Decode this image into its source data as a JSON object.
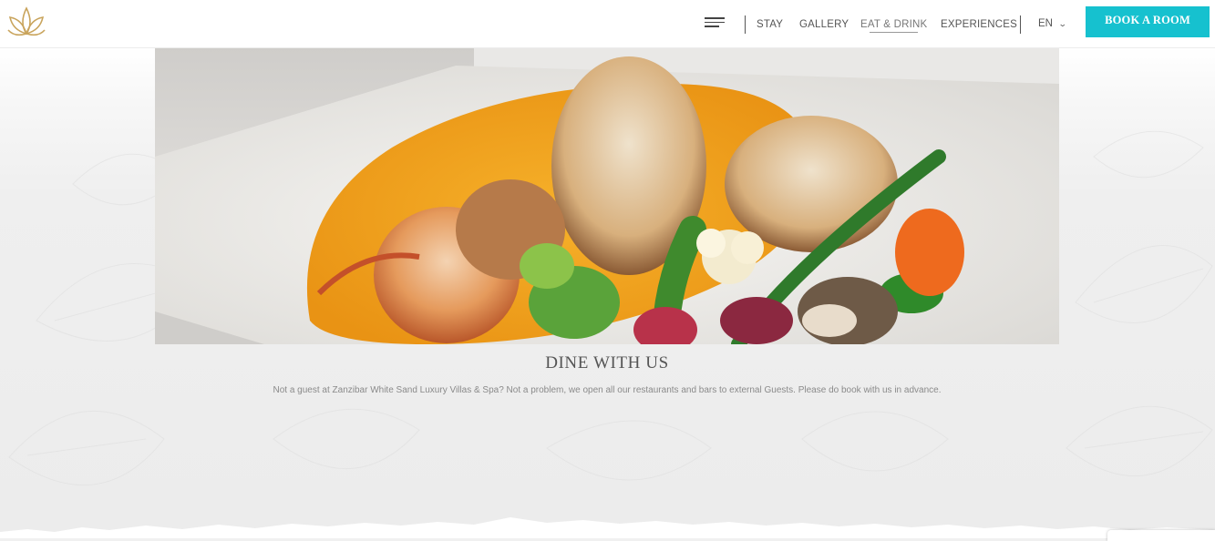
{
  "header": {
    "logo_icon": "lotus-logo-icon",
    "menu_icon": "hamburger-menu-icon",
    "nav": [
      {
        "label": "STAY",
        "active": false
      },
      {
        "label": "GALLERY",
        "active": false
      },
      {
        "label": "EAT & DRINK",
        "active": true
      },
      {
        "label": "EXPERIENCES",
        "active": false
      }
    ],
    "language": "EN",
    "language_icon": "chevron-down-icon",
    "book_label": "BOOK A ROOM"
  },
  "hero": {
    "image": "seafood-dish-photo"
  },
  "section": {
    "title": "DINE WITH US",
    "description": "Not a guest at Zanzibar White Sand Luxury Villas & Spa? Not a problem, we open all our restaurants and bars to external Guests. Please do book with us in advance."
  },
  "colors": {
    "accent": "#16c1cf",
    "logo_gold": "#c9a45c",
    "text_dark": "#555555",
    "text_muted": "#8a8a8a"
  }
}
